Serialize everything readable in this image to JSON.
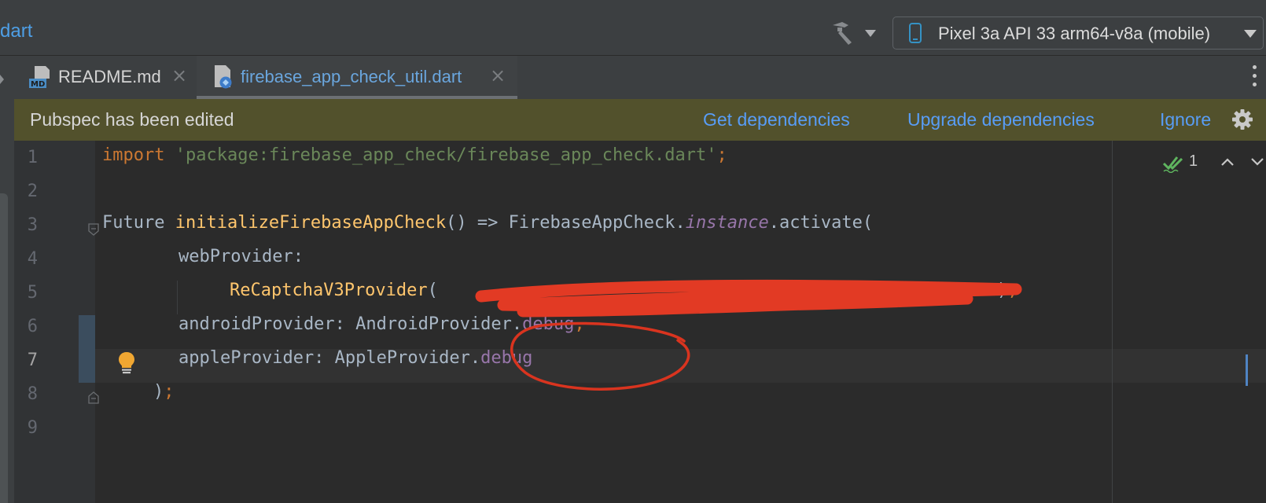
{
  "topbar": {
    "breadcrumb": "dart",
    "device": "Pixel 3a API 33 arm64-v8a (mobile)"
  },
  "tabs": [
    {
      "label": "README.md",
      "icon": "markdown-file-icon",
      "active": false
    },
    {
      "label": "firebase_app_check_util.dart",
      "icon": "dart-file-icon",
      "active": true
    }
  ],
  "banner": {
    "message": "Pubspec has been edited",
    "get_dependencies": "Get dependencies",
    "upgrade_dependencies": "Upgrade dependencies",
    "ignore": "Ignore"
  },
  "inspections": {
    "count": "1"
  },
  "editor": {
    "line_numbers": [
      "1",
      "2",
      "3",
      "4",
      "5",
      "6",
      "7",
      "8",
      "9"
    ],
    "current_line": 7,
    "code": {
      "l1_kw": "import",
      "l1_str": "'package:firebase_app_check/firebase_app_check.dart'",
      "l1_semi": ";",
      "l3_type": "Future ",
      "l3_fn": "initializeFirebaseAppCheck",
      "l3_mid": "() => FirebaseAppCheck.",
      "l3_it": "instance",
      "l3_end": ".activate(",
      "l4": "webProvider:",
      "l5_fn": "ReCaptchaV3Provider",
      "l5_paren": "(",
      "l5_close": ")",
      "l5_comma": ",",
      "l6_a": "androidProvider: AndroidProvider.",
      "l6_prop": "debug",
      "l6_comma": ",",
      "l7_a": "appleProvider: AppleProvider.",
      "l7_prop": "debug",
      "l8_a": ")",
      "l8_semi": ";"
    }
  },
  "colors": {
    "banner_bg": "#52512c",
    "link": "#589df6",
    "keyword": "#cc7832",
    "string": "#6a8759",
    "function": "#ffc66d",
    "property": "#9876aa",
    "annotation_red": "#e23a24"
  }
}
